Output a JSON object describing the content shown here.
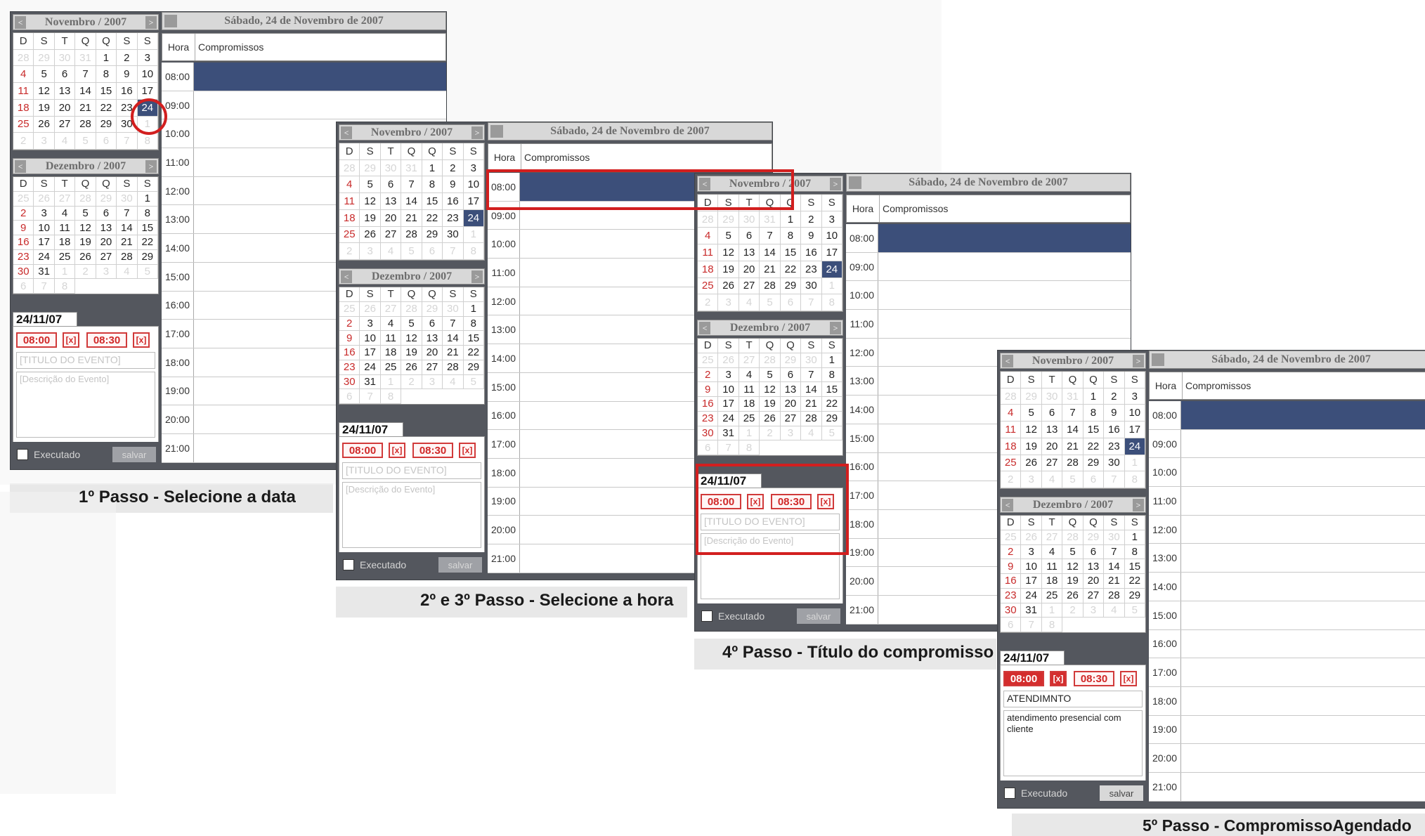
{
  "calendar": {
    "month1_title": "Novembro / 2007",
    "month2_title": "Dezembro / 2007",
    "day_headers": [
      "D",
      "S",
      "T",
      "Q",
      "Q",
      "S",
      "S"
    ],
    "nav_prev": "<",
    "nav_next": ">",
    "header_prev": "<",
    "nov_days": [
      28,
      29,
      30,
      31,
      1,
      2,
      3,
      4,
      5,
      6,
      7,
      8,
      9,
      10,
      11,
      12,
      13,
      14,
      15,
      16,
      17,
      18,
      19,
      20,
      21,
      22,
      23,
      24,
      25,
      26,
      27,
      28,
      29,
      30,
      1,
      2,
      3,
      4,
      5,
      6,
      7,
      8
    ],
    "dec_days": [
      25,
      26,
      27,
      28,
      29,
      30,
      1,
      2,
      3,
      4,
      5,
      6,
      7,
      8,
      9,
      10,
      11,
      12,
      13,
      14,
      15,
      16,
      17,
      18,
      19,
      20,
      21,
      22,
      23,
      24,
      25,
      26,
      27,
      28,
      29,
      30,
      31,
      1,
      2,
      3,
      4,
      5,
      6,
      7,
      8
    ],
    "selected_day": "24"
  },
  "event": {
    "date": "24/11/07",
    "start": "08:00",
    "end": "08:30",
    "clear": "[x]",
    "title_placeholder": "[TITULO DO EVENTO]",
    "desc_placeholder": "[Descrição do Evento]",
    "title_value": "ATENDIMNTO",
    "desc_value": "atendimento presencial com cliente",
    "executed_label": "Executado",
    "save_label": "salvar"
  },
  "schedule": {
    "header": "Sábado, 24 de Novembro de 2007",
    "col_hour": "Hora",
    "col_appointments": "Compromissos",
    "hours": [
      "08:00",
      "09:00",
      "10:00",
      "11:00",
      "12:00",
      "13:00",
      "14:00",
      "15:00",
      "16:00",
      "17:00",
      "18:00",
      "19:00",
      "20:00",
      "21:00"
    ]
  },
  "steps": [
    {
      "caption": "1º Passo - Selecione a data"
    },
    {
      "caption": "2º e 3º Passo - Selecione a hora"
    },
    {
      "caption": "4º Passo - Título do compromisso"
    },
    {
      "caption": "5º Passo - CompromissoAgendado"
    }
  ],
  "colors": {
    "panel": "#54575e",
    "selection": "#3c4f7a",
    "highlight": "#d21f1f",
    "sunday": "#c82a2a"
  }
}
